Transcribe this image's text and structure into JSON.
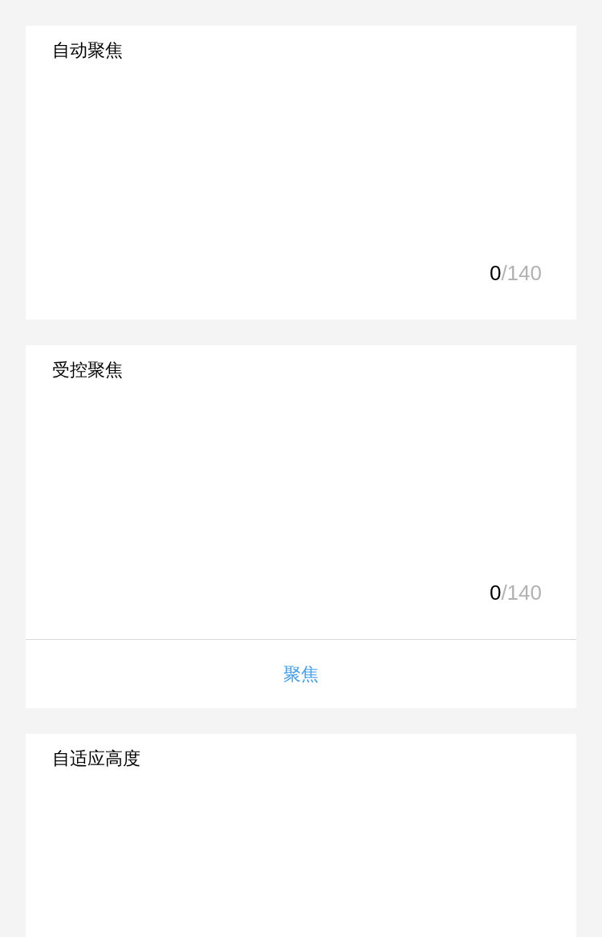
{
  "sections": [
    {
      "kind": "textarea",
      "label": "自动聚焦",
      "count": "0",
      "limit": "/140"
    },
    {
      "kind": "textarea",
      "label": "受控聚焦",
      "count": "0",
      "limit": "/140",
      "button": "聚焦"
    },
    {
      "kind": "autosize",
      "label": "自适应高度"
    }
  ]
}
